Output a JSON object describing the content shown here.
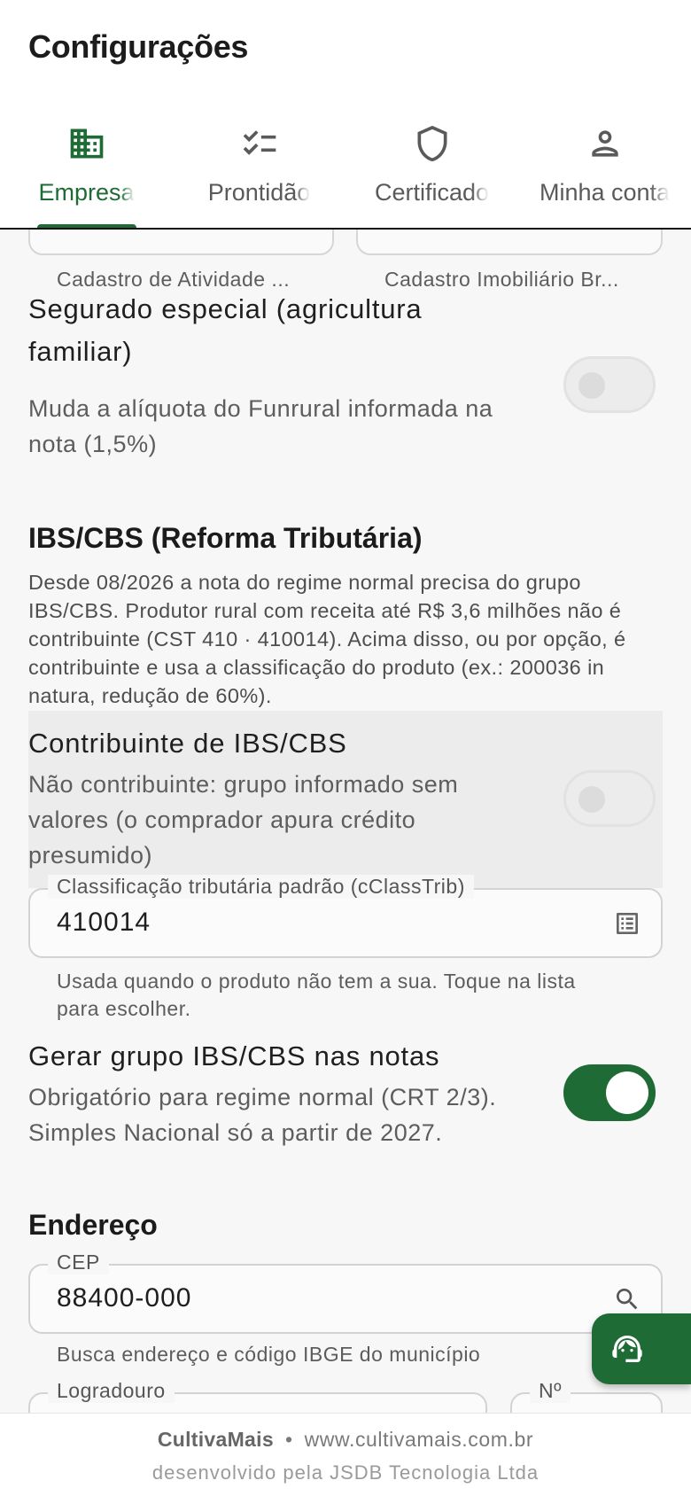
{
  "header": {
    "title": "Configurações",
    "tabs": [
      {
        "label": "Empresa",
        "icon": "building-icon",
        "active": true
      },
      {
        "label": "Prontidão",
        "icon": "checklist-icon",
        "active": false
      },
      {
        "label": "Certificado",
        "icon": "shield-icon",
        "active": false
      },
      {
        "label": "Minha conta",
        "icon": "person-icon",
        "active": false
      }
    ]
  },
  "top_fields": {
    "left_helper": "Cadastro de Atividade ...",
    "right_helper": "Cadastro Imobiliário Br..."
  },
  "segurado": {
    "title": "Segurado especial (agricultura familiar)",
    "subtitle": "Muda a alíquota do Funrural informada na nota (1,5%)",
    "enabled": false
  },
  "ibs": {
    "section_title": "IBS/CBS (Reforma Tributária)",
    "description": "Desde 08/2026 a nota do regime normal precisa do grupo IBS/CBS. Produtor rural com receita até R$ 3,6 milhões não é contribuinte (CST 410 · 410014). Acima disso, ou por opção, é contribuinte e usa a classificação do produto (ex.: 200036 in natura, redução de 60%).",
    "contribuinte_title": "Contribuinte de IBS/CBS",
    "contribuinte_subtitle": "Não contribuinte: grupo informado sem valores (o comprador apura crédito presumido)",
    "contribuinte_enabled": false,
    "cclass_label": "Classificação tributária padrão (cClassTrib)",
    "cclass_value": "410014",
    "cclass_helper": "Usada quando o produto não tem a sua. Toque na lista para escolher.",
    "gerar_title": "Gerar grupo IBS/CBS nas notas",
    "gerar_subtitle": "Obrigatório para regime normal (CRT 2/3). Simples Nacional só a partir de 2027.",
    "gerar_enabled": true
  },
  "endereco": {
    "section_title": "Endereço",
    "cep_label": "CEP",
    "cep_value": "88400-000",
    "cep_helper": "Busca endereço e código IBGE do município",
    "logradouro_label": "Logradouro",
    "numero_label": "Nº"
  },
  "footer": {
    "brand": "CultivaMais",
    "separator": "•",
    "site": "www.cultivamais.com.br",
    "credit": "desenvolvido pela JSDB Tecnologia Ltda"
  },
  "colors": {
    "accent": "#1e6b35",
    "background": "#f7f7f7",
    "surface": "#ffffff"
  }
}
